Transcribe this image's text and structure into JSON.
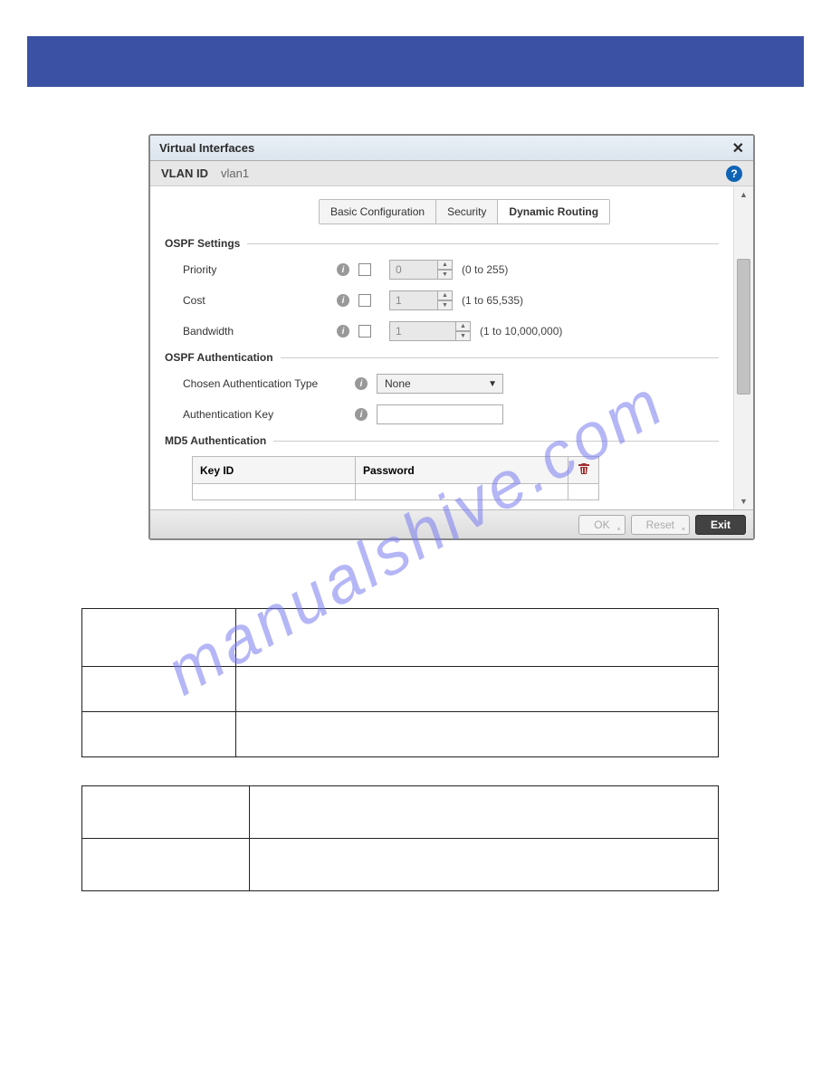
{
  "dialog": {
    "title": "Virtual Interfaces",
    "vlan_label": "VLAN ID",
    "vlan_value": "vlan1",
    "tabs": {
      "basic": "Basic Configuration",
      "security": "Security",
      "dynamic": "Dynamic Routing"
    },
    "ospf_settings": {
      "heading": "OSPF Settings",
      "priority": {
        "label": "Priority",
        "value": "0",
        "range": "(0 to 255)"
      },
      "cost": {
        "label": "Cost",
        "value": "1",
        "range": "(1 to 65,535)"
      },
      "bandwidth": {
        "label": "Bandwidth",
        "value": "1",
        "range": "(1 to 10,000,000)"
      }
    },
    "ospf_auth": {
      "heading": "OSPF Authentication",
      "chosen_type": {
        "label": "Chosen Authentication Type",
        "value": "None"
      },
      "auth_key": {
        "label": "Authentication Key"
      }
    },
    "md5": {
      "heading": "MD5 Authentication",
      "col_key": "Key ID",
      "col_password": "Password"
    },
    "footer": {
      "ok": "OK",
      "reset": "Reset",
      "exit": "Exit"
    }
  },
  "watermark": "manualshive.com"
}
